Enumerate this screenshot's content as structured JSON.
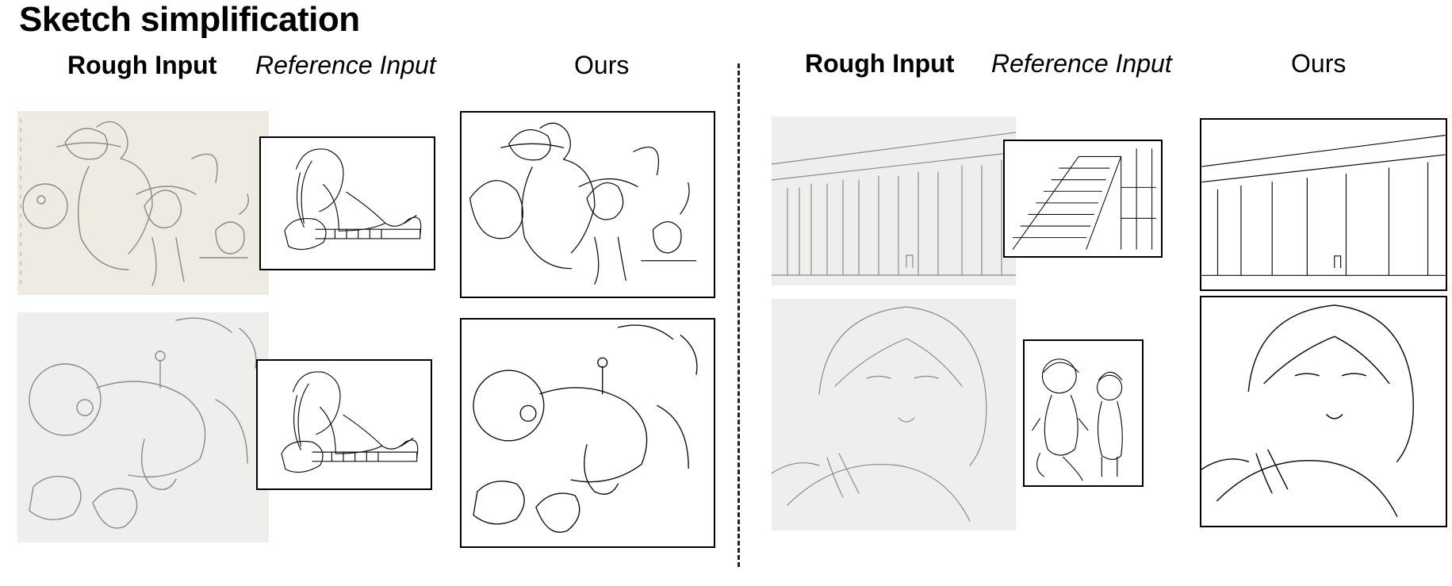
{
  "title": "Sketch simplification",
  "left_group": {
    "rough_header": "Rough Input",
    "reference_header": "Reference Input",
    "ours_header": "Ours"
  },
  "right_group": {
    "rough_header": "Rough Input",
    "reference_header": "Reference Input",
    "ours_header": "Ours"
  },
  "images": {
    "left_row1_rough": "rough pencil sketch: cowboy dinosaur, girl with hat and cat",
    "left_row1_reference": "line drawing: girl playing guitar",
    "left_row1_ours": "simplified line art: cowboy dinosaur, girl and cat",
    "left_row2_rough": "rough pencil sketch: robot arm",
    "left_row2_reference": "line drawing: girl playing guitar",
    "left_row2_ours": "simplified line art: robot arm",
    "right_row1_rough": "rough pencil sketch: building with columns",
    "right_row1_reference": "line drawing: staircase",
    "right_row1_ours": "simplified line art: building with columns",
    "right_row2_rough": "rough pencil sketch: girl with bob hair",
    "right_row2_reference": "line drawing: two small characters",
    "right_row2_ours": "simplified line art: girl with bob hair"
  },
  "colors": {
    "pencil": "#8a8a86",
    "ink": "#111111"
  }
}
